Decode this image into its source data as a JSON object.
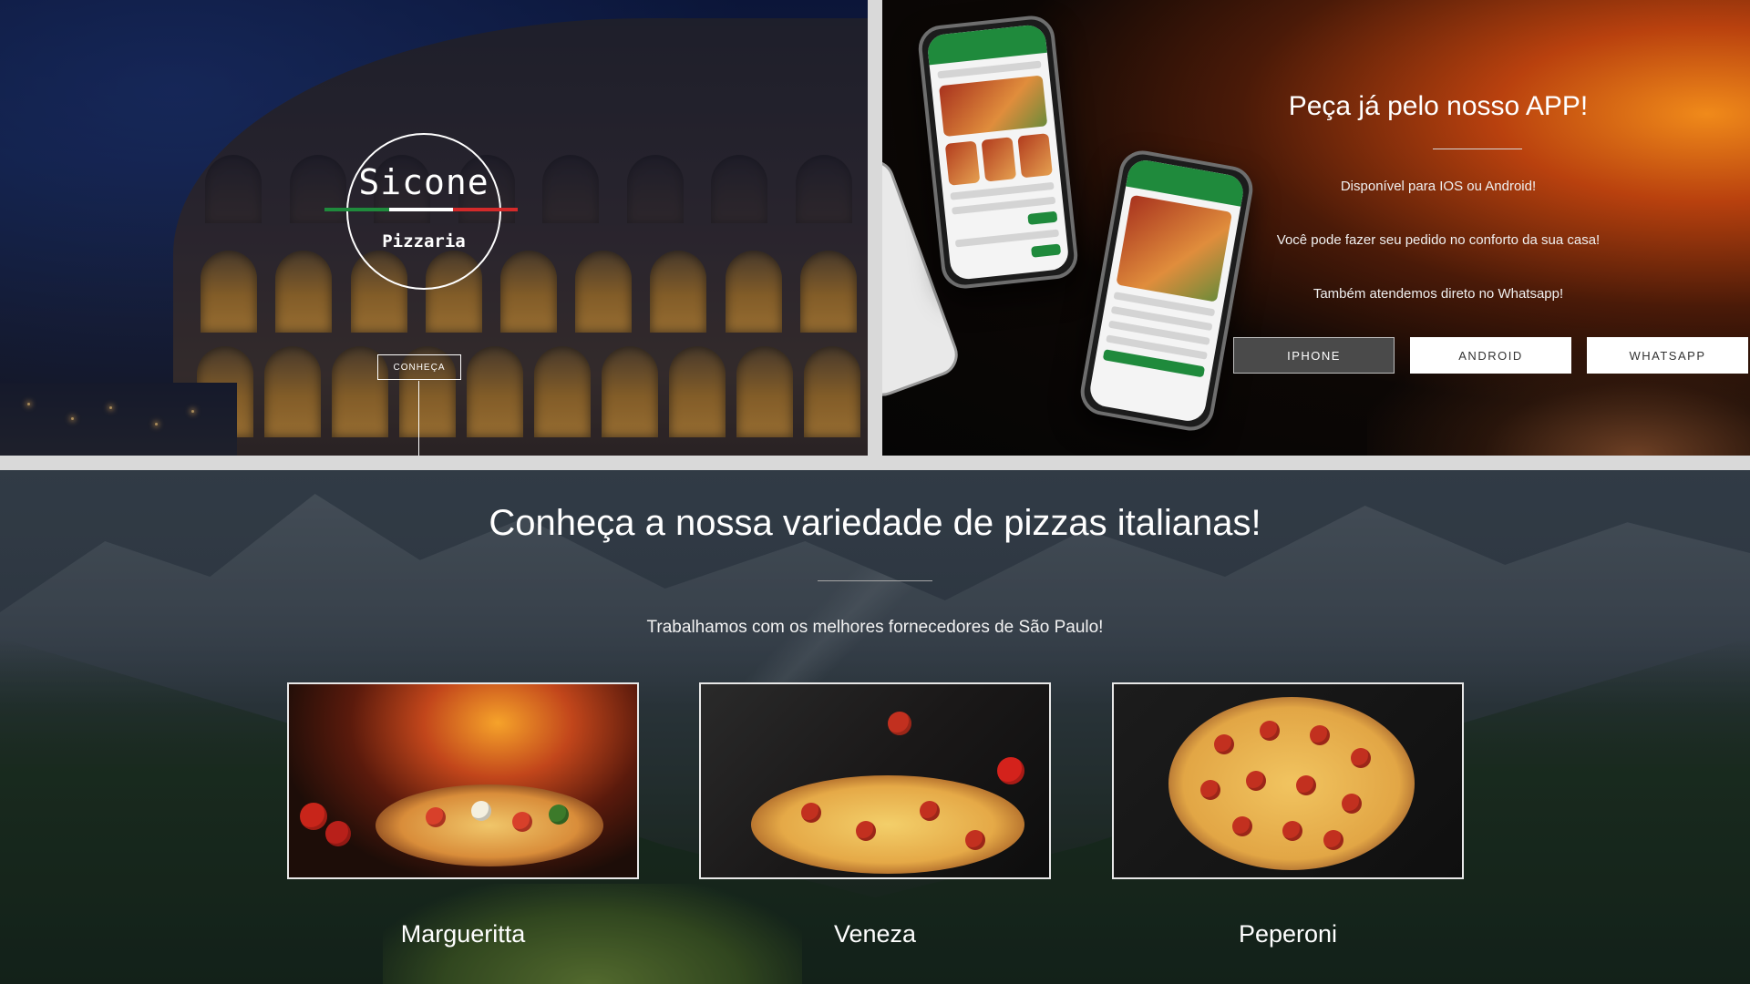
{
  "hero": {
    "logo_name": "Sicone",
    "logo_sub": "Pizzaria",
    "cta_label": "CONHEÇA",
    "flag_colors": [
      "#1f8a3c",
      "#ffffff",
      "#d42a2a"
    ]
  },
  "app": {
    "title": "Peça já pelo nosso APP!",
    "lines": [
      "Disponível para IOS ou Android!",
      "Você pode fazer seu pedido no conforto da sua casa!",
      "Também atendemos direto no Whatsapp!"
    ],
    "buttons": [
      "IPHONE",
      "ANDROID",
      "WHATSAPP"
    ],
    "accent": "#1f8a3c"
  },
  "pizzas": {
    "title": "Conheça a nossa variedade de pizzas italianas!",
    "subtitle": "Trabalhamos com os melhores fornecedores de São Paulo!",
    "items": [
      {
        "name": "Margueritta"
      },
      {
        "name": "Veneza"
      },
      {
        "name": "Peperoni"
      }
    ]
  }
}
